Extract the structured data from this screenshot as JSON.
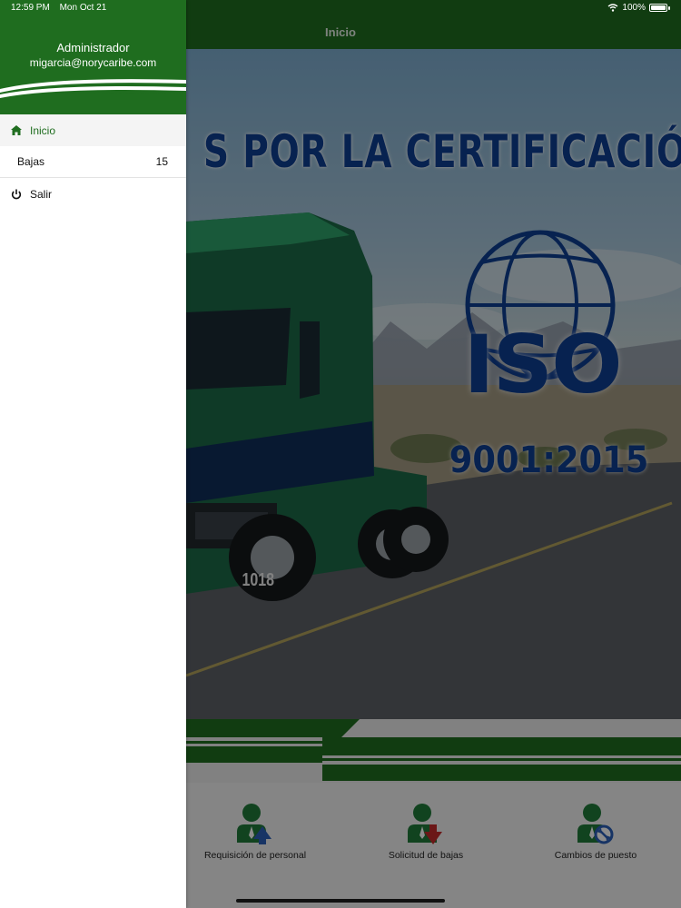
{
  "status_bar": {
    "time": "12:59 PM",
    "date": "Mon Oct 21",
    "battery": "100%"
  },
  "navbar": {
    "title": "Inicio"
  },
  "banner": {
    "headline": "S POR LA CERTIFICACIÓN",
    "iso_word": "ISO",
    "iso_number": "9001:2015",
    "truck_number": "1018"
  },
  "actions": [
    {
      "label": "Requisición de personal",
      "icon": "person-up-arrow-icon"
    },
    {
      "label": "Solicitud de bajas",
      "icon": "person-down-arrow-icon"
    },
    {
      "label": "Cambios de puesto",
      "icon": "person-refresh-icon"
    }
  ],
  "drawer": {
    "user_name": "Administrador",
    "user_email": "migarcia@norycaribe.com",
    "items": [
      {
        "label": "Inicio",
        "icon": "home-icon",
        "active": true
      },
      {
        "label": "Bajas",
        "badge": "15"
      },
      {
        "label": "Salir",
        "icon": "power-icon"
      }
    ]
  },
  "colors": {
    "brand_green": "#1f6d1f",
    "iso_blue": "#0e3e93"
  }
}
